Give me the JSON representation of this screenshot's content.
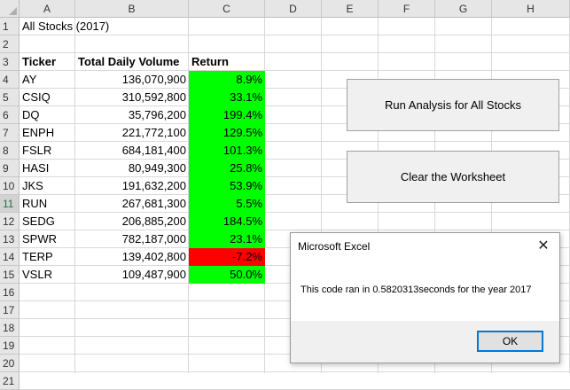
{
  "columns": [
    "A",
    "B",
    "C",
    "D",
    "E",
    "F",
    "G",
    "H"
  ],
  "rows": [
    "1",
    "2",
    "3",
    "4",
    "5",
    "6",
    "7",
    "8",
    "9",
    "10",
    "11",
    "12",
    "13",
    "14",
    "15",
    "16",
    "17",
    "18",
    "19",
    "20",
    "21"
  ],
  "sheet_title": "All Stocks (2017)",
  "headers": {
    "ticker": "Ticker",
    "volume": "Total Daily Volume",
    "return": "Return"
  },
  "stocks": [
    {
      "ticker": "AY",
      "volume": "136,070,900",
      "return": "8.9%",
      "positive": true
    },
    {
      "ticker": "CSIQ",
      "volume": "310,592,800",
      "return": "33.1%",
      "positive": true
    },
    {
      "ticker": "DQ",
      "volume": "35,796,200",
      "return": "199.4%",
      "positive": true
    },
    {
      "ticker": "ENPH",
      "volume": "221,772,100",
      "return": "129.5%",
      "positive": true
    },
    {
      "ticker": "FSLR",
      "volume": "684,181,400",
      "return": "101.3%",
      "positive": true
    },
    {
      "ticker": "HASI",
      "volume": "80,949,300",
      "return": "25.8%",
      "positive": true
    },
    {
      "ticker": "JKS",
      "volume": "191,632,200",
      "return": "53.9%",
      "positive": true
    },
    {
      "ticker": "RUN",
      "volume": "267,681,300",
      "return": "5.5%",
      "positive": true
    },
    {
      "ticker": "SEDG",
      "volume": "206,885,200",
      "return": "184.5%",
      "positive": true
    },
    {
      "ticker": "SPWR",
      "volume": "782,187,000",
      "return": "23.1%",
      "positive": true
    },
    {
      "ticker": "TERP",
      "volume": "139,402,800",
      "return": "-7.2%",
      "positive": false
    },
    {
      "ticker": "VSLR",
      "volume": "109,487,900",
      "return": "50.0%",
      "positive": true
    }
  ],
  "buttons": {
    "run": "Run Analysis for All Stocks",
    "clear": "Clear the Worksheet"
  },
  "dialog": {
    "title": "Microsoft Excel",
    "close": "✕",
    "message": "This code ran in 0.5820313seconds for the year 2017",
    "ok": "OK"
  },
  "colors": {
    "positive": "#00ff00",
    "negative": "#ff0000",
    "header_bg": "#e6e6e6"
  }
}
